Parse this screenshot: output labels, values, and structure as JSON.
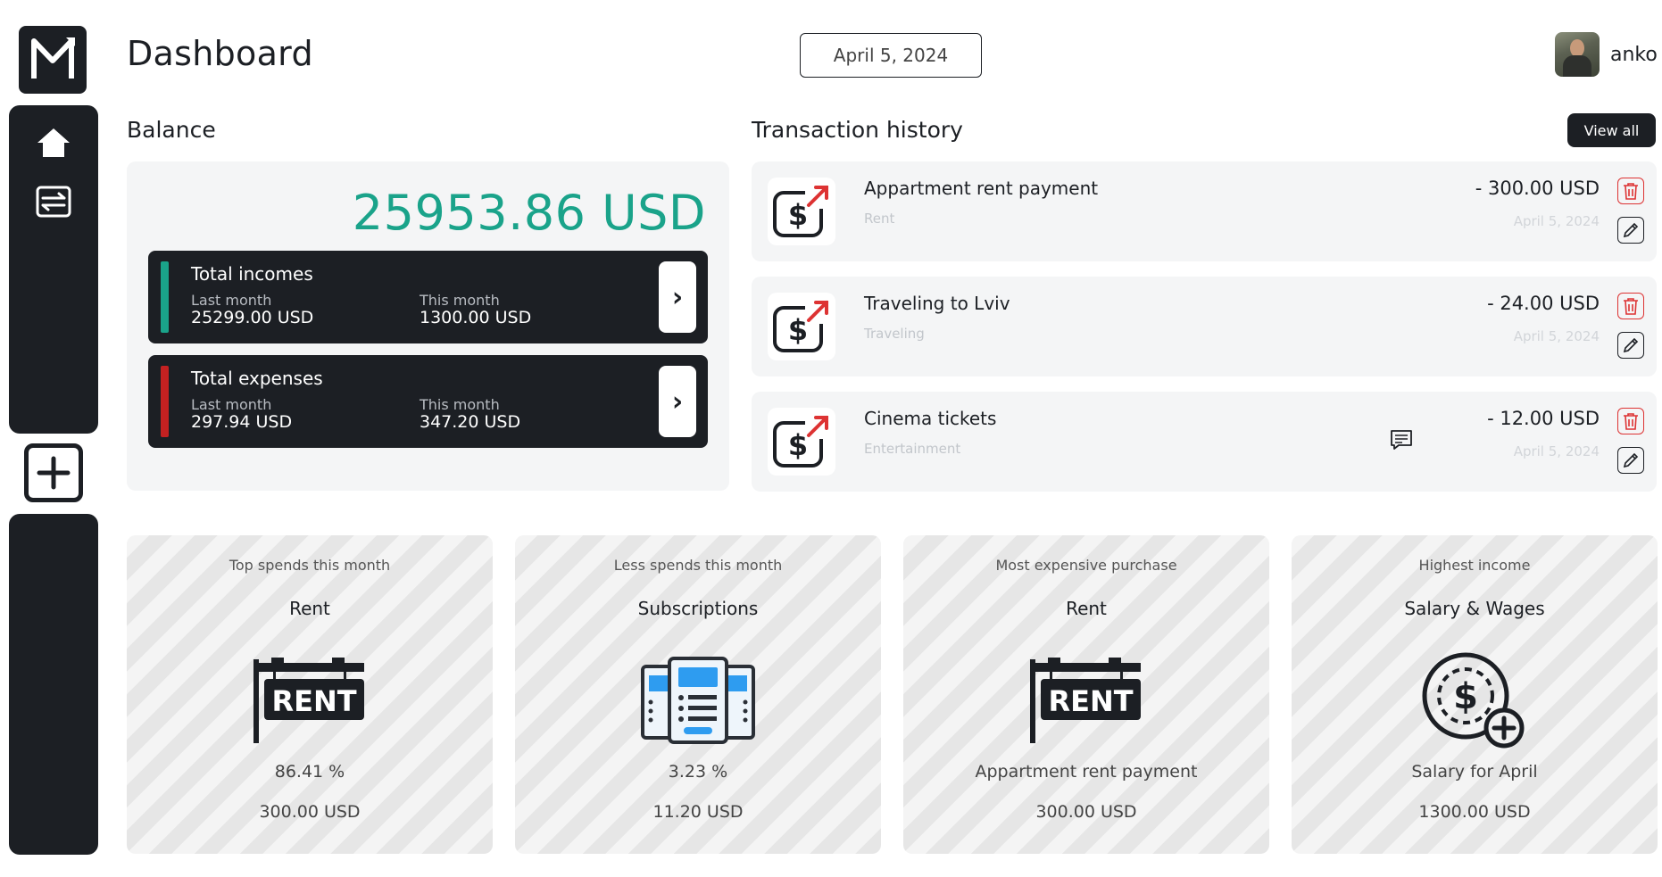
{
  "header": {
    "title": "Dashboard",
    "date": "April 5, 2024",
    "username": "anko"
  },
  "balance": {
    "section_title": "Balance",
    "amount": "25953.86 USD",
    "incomes": {
      "title": "Total incomes",
      "last_label": "Last month",
      "last_value": "25299.00 USD",
      "this_label": "This month",
      "this_value": "1300.00 USD",
      "accent": "#1aa38a"
    },
    "expenses": {
      "title": "Total expenses",
      "last_label": "Last month",
      "last_value": "297.94 USD",
      "this_label": "This month",
      "this_value": "347.20 USD",
      "accent": "#c42121"
    }
  },
  "transactions": {
    "section_title": "Transaction history",
    "view_all": "View all",
    "items": [
      {
        "name": "Appartment rent payment",
        "category": "Rent",
        "amount": "- 300.00 USD",
        "date": "April 5, 2024",
        "has_comment": false
      },
      {
        "name": "Traveling to Lviv",
        "category": "Traveling",
        "amount": "- 24.00 USD",
        "date": "April 5, 2024",
        "has_comment": false
      },
      {
        "name": "Cinema tickets",
        "category": "Entertainment",
        "amount": "- 12.00 USD",
        "date": "April 5, 2024",
        "has_comment": true
      }
    ]
  },
  "cards": [
    {
      "label": "Top spends this month",
      "title": "Rent",
      "icon": "rent-sign-icon",
      "line1": "86.41 %",
      "line2": "300.00 USD"
    },
    {
      "label": "Less spends this month",
      "title": "Subscriptions",
      "icon": "subscriptions-icon",
      "line1": "3.23 %",
      "line2": "11.20 USD"
    },
    {
      "label": "Most expensive purchase",
      "title": "Rent",
      "icon": "rent-sign-icon",
      "line1": "Appartment rent payment",
      "line2": "300.00 USD"
    },
    {
      "label": "Highest income",
      "title": "Salary & Wages",
      "icon": "salary-coin-icon",
      "line1": "Salary for April",
      "line2": "1300.00 USD"
    }
  ],
  "colors": {
    "dark": "#1c1f24",
    "income_green": "#1aa38a",
    "expense_red": "#c42121"
  }
}
